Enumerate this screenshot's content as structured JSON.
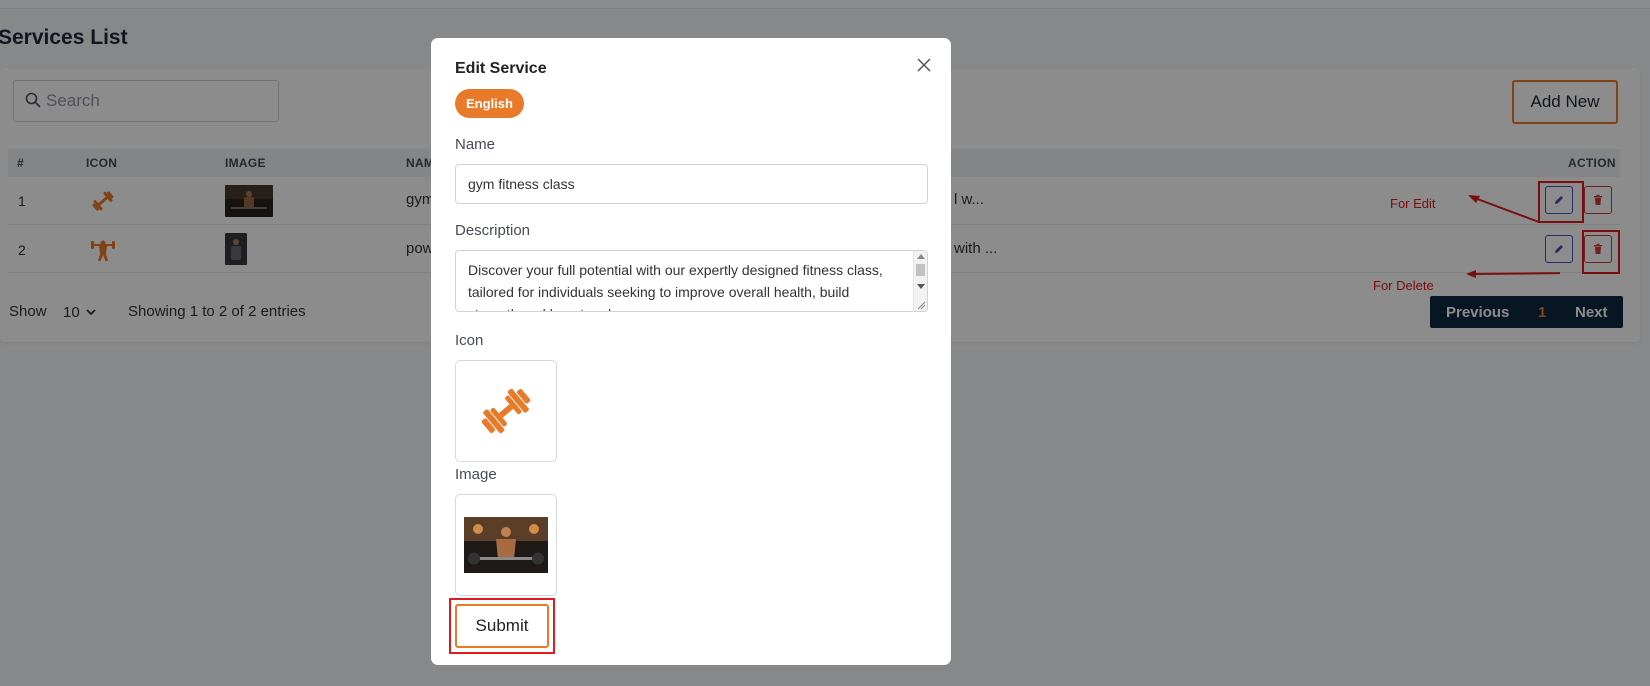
{
  "page": {
    "title": "Services List"
  },
  "search": {
    "placeholder": "Search"
  },
  "toolbar": {
    "add_new_label": "Add New"
  },
  "table": {
    "headers": {
      "num": "#",
      "icon": "ICON",
      "image": "IMAGE",
      "name": "NAM",
      "action": "ACTION"
    },
    "rows": [
      {
        "num": "1",
        "icon": "dumbbell-icon",
        "image": "gym-athlete-thumbnail",
        "name": "gym",
        "desc_tail": "l w..."
      },
      {
        "num": "2",
        "icon": "weightlifter-icon",
        "image": "powerlifter-thumbnail",
        "name": "pow",
        "desc_tail": "with ..."
      }
    ]
  },
  "footer": {
    "show_label": "Show",
    "page_size": "10",
    "entries_text": "Showing 1 to 2 of 2 entries",
    "prev_label": "Previous",
    "current_page": "1",
    "next_label": "Next"
  },
  "annotations": {
    "edit_label": "For Edit",
    "delete_label": "For Delete"
  },
  "modal": {
    "title": "Edit Service",
    "language_tab": "English",
    "name_label": "Name",
    "name_value": "gym fitness class",
    "description_label": "Description",
    "description_lines": [
      "Discover your full potential with our expertly designed fitness class,",
      "tailored for individuals seeking to improve overall health, build",
      "strength and boost endurance."
    ],
    "icon_label": "Icon",
    "icon_preview": "dumbbell-icon",
    "image_label": "Image",
    "image_preview": "gym-athlete-photo",
    "submit_label": "Submit"
  },
  "colors": {
    "accent": "#e87a2a",
    "navy": "#0f2740",
    "edit_blue": "#4a4cb8",
    "delete_red": "#d33a3a",
    "annotation_red": "#e11b1b",
    "overlay": "rgba(0,0,0,0.45)"
  }
}
